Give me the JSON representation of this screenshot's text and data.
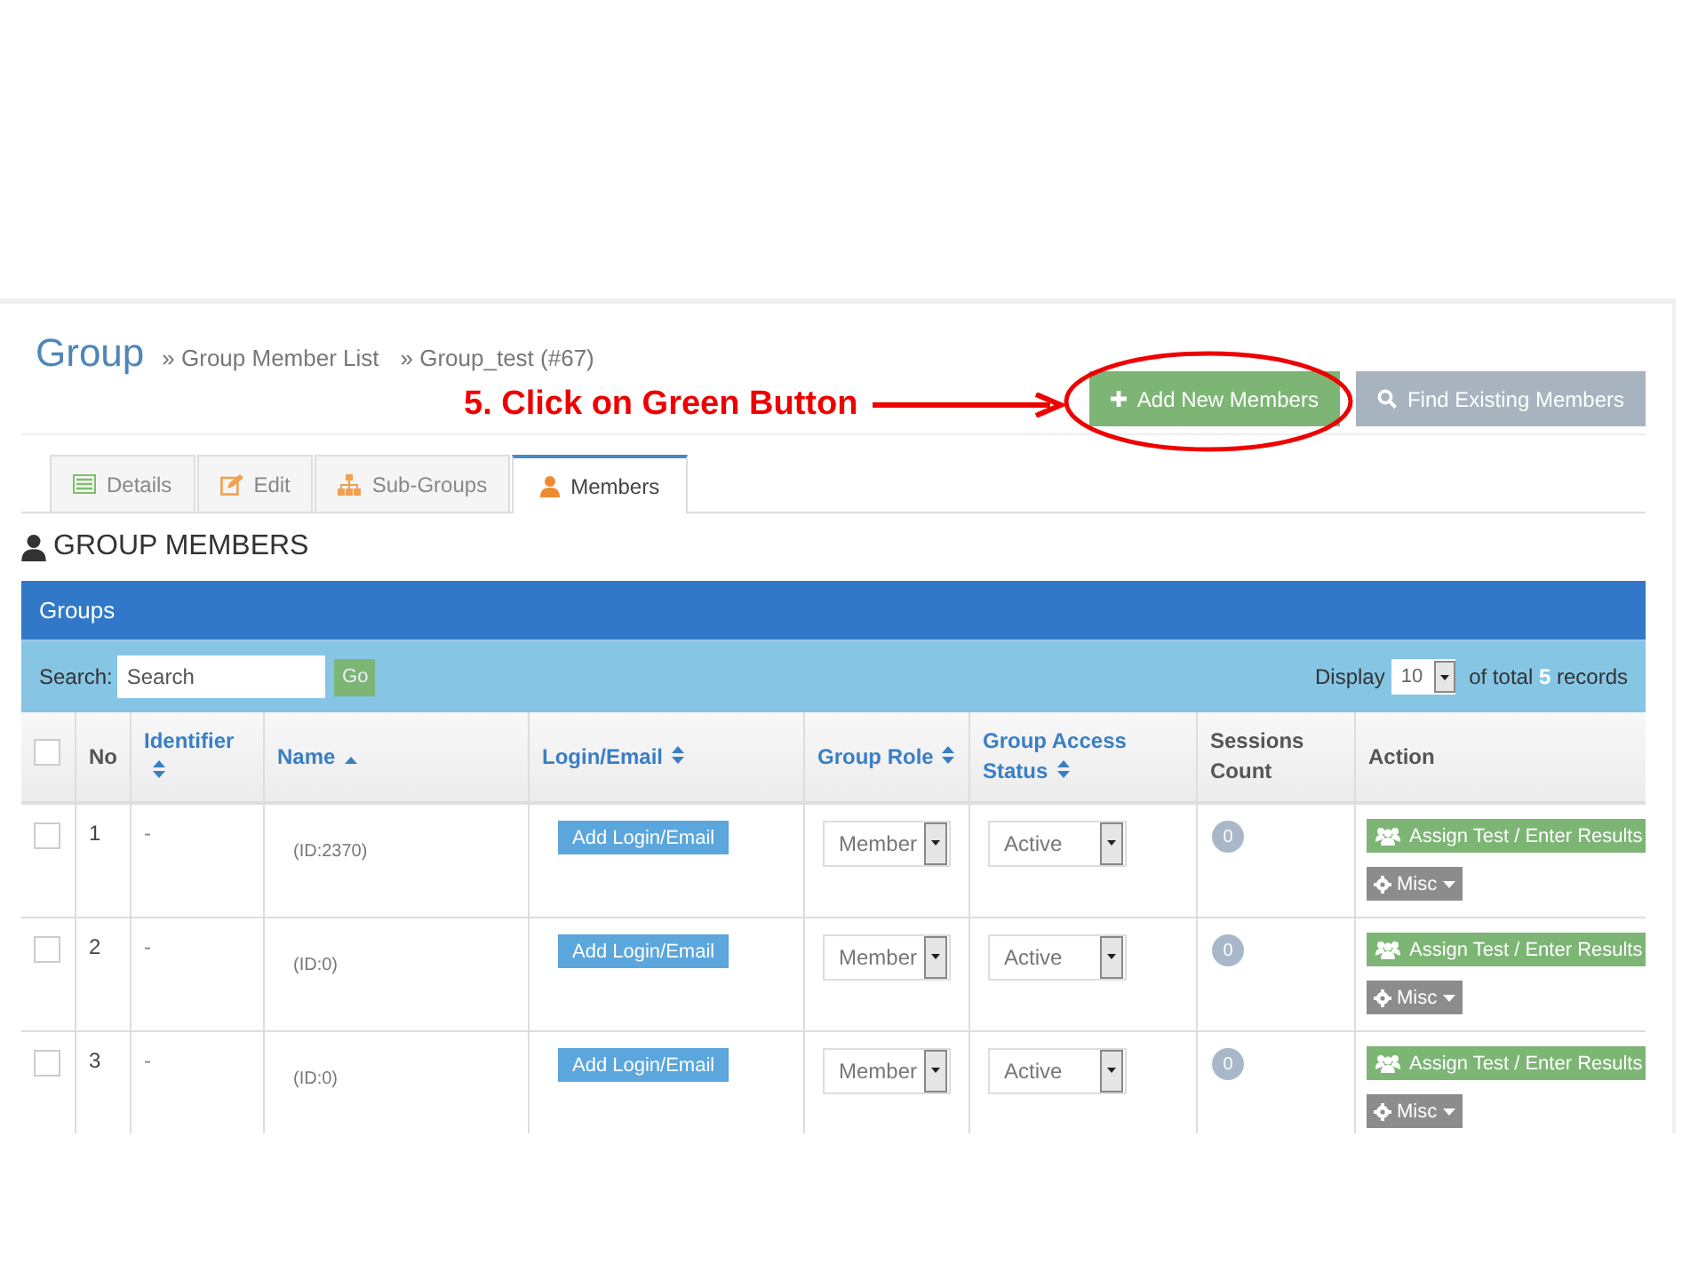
{
  "header": {
    "title": "Group",
    "breadcrumbs": [
      "» Group Member List",
      "» Group_test (#67)"
    ]
  },
  "annotation": {
    "text": "5. Click on Green Button"
  },
  "header_buttons": [
    {
      "label": "Add New Members",
      "kind": "add",
      "highlighted": true
    },
    {
      "label": "Find Existing Members",
      "kind": "find",
      "highlighted": false
    }
  ],
  "tabs": [
    {
      "label": "Details",
      "selected": false
    },
    {
      "label": "Edit",
      "selected": false
    },
    {
      "label": "Sub-Groups",
      "selected": false
    },
    {
      "label": "Members",
      "selected": true
    }
  ],
  "section_title": "GROUP MEMBERS",
  "panel": {
    "title": "Groups",
    "search": {
      "label": "Search:",
      "placeholder": "Search",
      "button": "Go"
    },
    "display": {
      "label": "Display",
      "value": "10",
      "total_prefix": "of total",
      "total": "5",
      "total_suffix": "records"
    }
  },
  "table": {
    "select_all_checked": false,
    "columns": [
      {
        "label": "No",
        "sortable": false,
        "sorted": false
      },
      {
        "label": "Identifier",
        "sortable": true,
        "sorted": false
      },
      {
        "label": "Name",
        "sortable": true,
        "sorted": true
      },
      {
        "label": "Login/Email",
        "sortable": true,
        "sorted": false
      },
      {
        "label": "Group Role",
        "sortable": true,
        "sorted": false
      },
      {
        "label": "Group Access Status",
        "sortable": true,
        "sorted": false
      },
      {
        "label": "Sessions Count",
        "sortable": false,
        "sorted": false
      },
      {
        "label": "Action",
        "sortable": false,
        "sorted": false
      }
    ],
    "rows": [
      {
        "checked": false,
        "no": "1",
        "identifier": "-",
        "name": "(ID:2370)",
        "login_button": "Add Login/Email",
        "role": "Member",
        "status": "Active",
        "sessions": "0",
        "assign_button": "Assign Test / Enter Results",
        "misc_button": "Misc"
      },
      {
        "checked": false,
        "no": "2",
        "identifier": "-",
        "name": "(ID:0)",
        "login_button": "Add Login/Email",
        "role": "Member",
        "status": "Active",
        "sessions": "0",
        "assign_button": "Assign Test / Enter Results",
        "misc_button": "Misc"
      },
      {
        "checked": false,
        "no": "3",
        "identifier": "-",
        "name": "(ID:0)",
        "login_button": "Add Login/Email",
        "role": "Member",
        "status": "Active",
        "sessions": "0",
        "assign_button": "Assign Test / Enter Results",
        "misc_button": "Misc"
      }
    ]
  }
}
